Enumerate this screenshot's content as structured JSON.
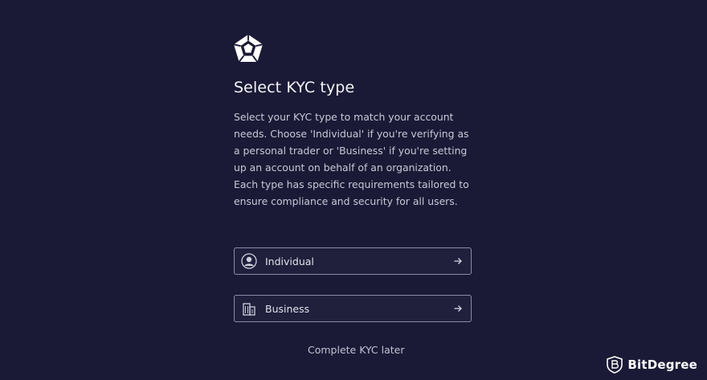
{
  "brand": {
    "logo_icon": "pentagon-logo-icon"
  },
  "header": {
    "title": "Select KYC type",
    "description": "Select your KYC type to match your account needs. Choose 'Individual' if you're verifying as a personal trader or 'Business' if you're setting up an account on behalf of an organization. Each type has specific requirements tailored to ensure compliance and security for all users."
  },
  "options": [
    {
      "label": "Individual",
      "icon": "user-icon",
      "arrow": "arrow-right-icon"
    },
    {
      "label": "Business",
      "icon": "building-icon",
      "arrow": "arrow-right-icon"
    }
  ],
  "footer": {
    "later_link": "Complete KYC later"
  },
  "watermark": {
    "text": "BitDegree",
    "icon": "bitdegree-shield-icon"
  },
  "colors": {
    "background": "#1b1a36",
    "border": "#8d8ca6",
    "text": "#e6e6ef"
  }
}
